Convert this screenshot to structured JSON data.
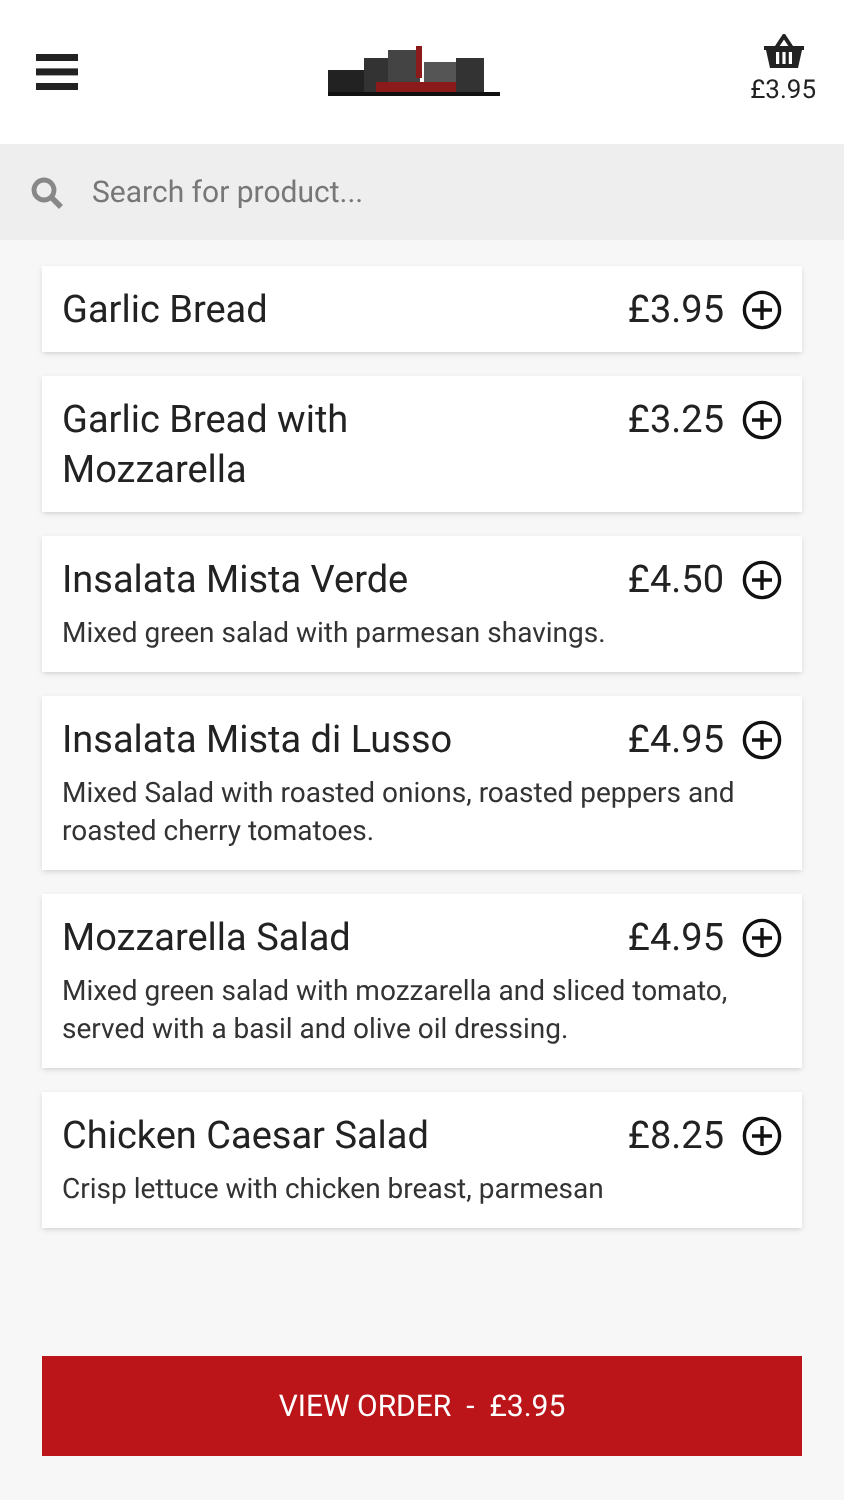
{
  "header": {
    "cart_total": "£3.95"
  },
  "search": {
    "placeholder": "Search for product..."
  },
  "products": [
    {
      "name": "Garlic Bread",
      "price": "£3.95"
    },
    {
      "name": "Garlic Bread with Mozzarella",
      "price": "£3.25"
    },
    {
      "name": "Insalata Mista Verde",
      "price": "£4.50",
      "description": "Mixed green salad with parmesan shavings."
    },
    {
      "name": "Insalata Mista di Lusso",
      "price": "£4.95",
      "description": "Mixed Salad with roasted onions, roasted peppers and roasted cherry tomatoes."
    },
    {
      "name": "Mozzarella Salad",
      "price": "£4.95",
      "description": "Mixed green salad with mozzarella and sliced tomato, served with a basil and olive oil dressing."
    },
    {
      "name": "Chicken Caesar Salad",
      "price": "£8.25",
      "description": "Crisp lettuce with chicken breast, parmesan"
    }
  ],
  "order_button": {
    "label": "VIEW ORDER  -  £3.95"
  }
}
